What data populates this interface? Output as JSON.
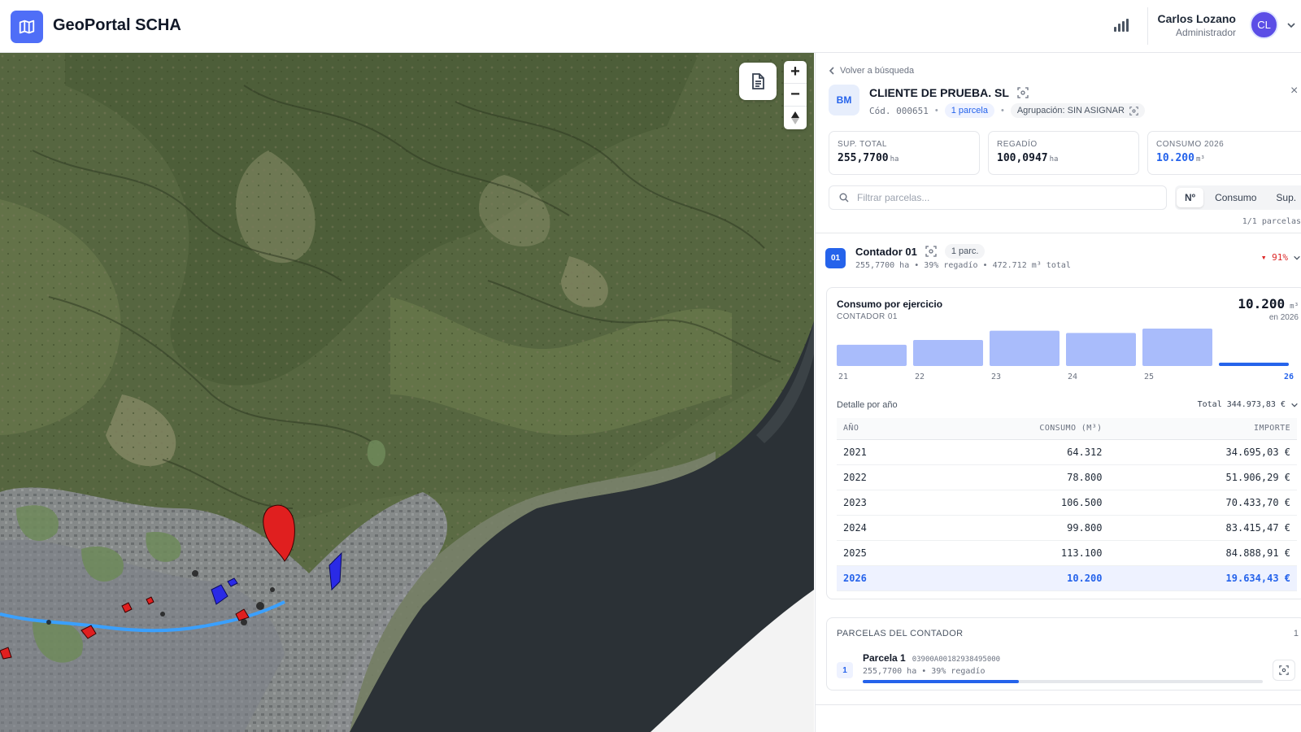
{
  "header": {
    "app_title": "GeoPortal SCHA",
    "logo_icon": "map-icon",
    "stats_icon": "bar-chart-icon",
    "user_name": "Carlos Lozano",
    "user_role": "Administrador",
    "avatar_initials": "CL",
    "accent": "#4f6ef7"
  },
  "map": {
    "document_button_icon": "document-icon",
    "zoom_in": "+",
    "zoom_out": "−",
    "compass_icon": "compass-icon",
    "parcel_color": "#e01f1f",
    "river_color": "#3aa0ff"
  },
  "panel": {
    "back_label": "Volver a búsqueda",
    "close_label": "×",
    "client": {
      "badge": "BM",
      "name": "CLIENTE DE PRUEBA. SL",
      "code": "Cód. 000651",
      "parcels_pill": "1 parcela",
      "group_pill": "Agrupación: SIN ASIGNAR"
    },
    "stats": [
      {
        "label": "SUP. TOTAL",
        "value": "255,7700",
        "unit": "ha"
      },
      {
        "label": "REGADÍO",
        "value": "100,0947",
        "unit": "ha"
      },
      {
        "label": "CONSUMO 2026",
        "value": "10.200",
        "unit": "m³"
      }
    ],
    "filter_placeholder": "Filtrar parcelas...",
    "sort_buttons": [
      "Nº",
      "Consumo",
      "Sup."
    ],
    "count_label": "1/1 parcelas",
    "meter": {
      "number": "01",
      "name": "Contador 01",
      "pill": "1 parc.",
      "meta": "255,7700 ha • 39% regadío • 472.712 m³ total",
      "trend": "▾ 91%",
      "trend_color": "#dc2626"
    },
    "consumption": {
      "title": "Consumo por ejercicio",
      "subtitle": "CONTADOR 01",
      "total": "10.200",
      "total_unit": "m³",
      "total_year": "en 2026",
      "detail_title": "Detalle por año",
      "detail_total": "Total 344.973,83 €",
      "columns": [
        "AÑO",
        "CONSUMO (M³)",
        "IMPORTE"
      ],
      "rows": [
        {
          "year": "2021",
          "consumo": "64.312",
          "importe": "34.695,03 €"
        },
        {
          "year": "2022",
          "consumo": "78.800",
          "importe": "51.906,29 €"
        },
        {
          "year": "2023",
          "consumo": "106.500",
          "importe": "70.433,70 €"
        },
        {
          "year": "2024",
          "consumo": "99.800",
          "importe": "83.415,47 €"
        },
        {
          "year": "2025",
          "consumo": "113.100",
          "importe": "84.888,91 €"
        },
        {
          "year": "2026",
          "consumo": "10.200",
          "importe": "19.634,43 €"
        }
      ]
    },
    "parcels": {
      "title": "PARCELAS DEL CONTADOR",
      "count": "1",
      "items": [
        {
          "num": "1",
          "name": "Parcela 1",
          "ref": "03900A00182938495000",
          "meta": "255,7700 ha • 39% regadío",
          "irrigated_fraction": 0.39
        }
      ]
    }
  },
  "chart_data": {
    "type": "bar",
    "title": "Consumo por ejercicio",
    "categories": [
      "21",
      "22",
      "23",
      "24",
      "25",
      "26"
    ],
    "values": [
      64312,
      78800,
      106500,
      99800,
      113100,
      10200
    ],
    "highlight": "26",
    "colors": {
      "bar": "#a9bcfb",
      "highlight": "#2563eb"
    }
  }
}
